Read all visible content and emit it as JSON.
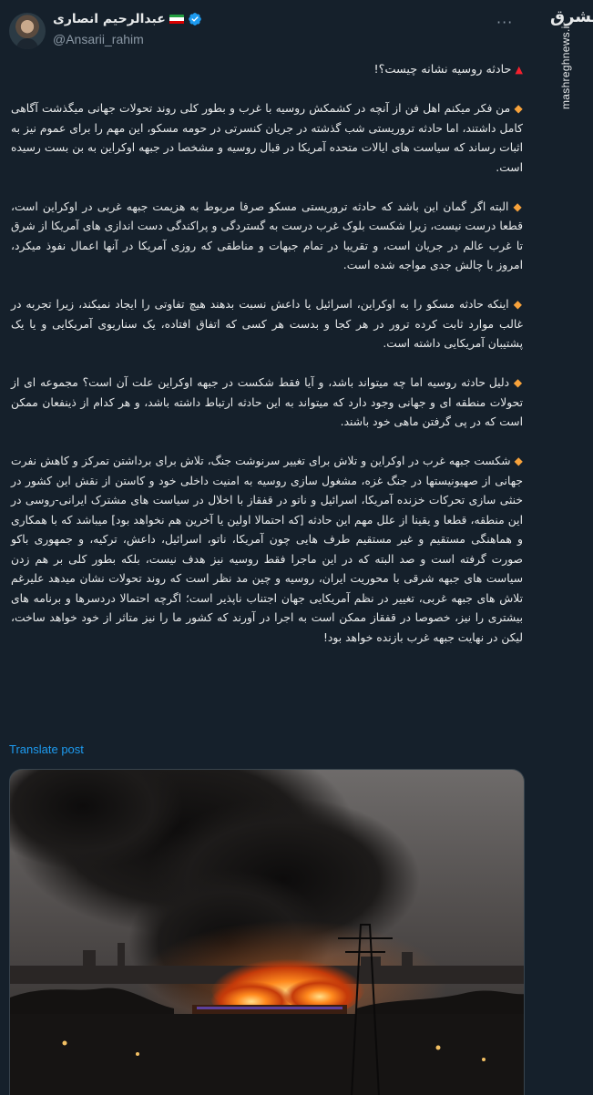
{
  "author": {
    "display_name": "عبدالرحیم انصاری",
    "handle": "@Ansarii_rahim",
    "flag_colors": [
      "#239f40",
      "#ffffff",
      "#da0000"
    ],
    "verified_color": "#1d9bf0"
  },
  "watermark": {
    "logo": "مشرق",
    "site": "mashreghnews.ir"
  },
  "tweet": {
    "title": "حادثه روسیه نشانه چیست؟!",
    "paragraphs": [
      "من فکر میکنم اهل فن از آنچه در کشمکش روسیه با غرب و بطور کلی روند تحولات جهانی میگذشت آگاهی کامل داشتند، اما حادثه تروریستی شب گذشته در جریان کنسرتی در حومه مسکو، این مهم را برای عموم نیز به اثبات رساند که سیاست های ایالات متحده آمریکا در قبال روسیه و مشخصا در جبهه اوکراین به بن بست رسیده است.",
      "البته اگر گمان این باشد که حادثه تروریستی مسکو صرفا مربوط به هزیمت جبهه غربی در اوکراین است، قطعا درست نیست، زیرا شکست بلوک غرب درست به گستردگی و پراکندگی دست اندازی های آمریکا از شرق تا غرب عالم در جریان است، و تقریبا در تمام جبهات و مناطقی که روزی آمریکا در آنها اعمال نفوذ میکرد، امروز با چالش جدی مواجه شده است.",
      "اینکه حادثه مسکو را به اوکراین، اسرائیل یا داعش نسبت بدهند هیچ تفاوتی را ایجاد نمیکند، زیرا تجربه در غالب موارد ثابت کرده ترور در هر کجا و بدست هر کسی که اتفاق افتاده، یک سناریوی آمریکایی و یا یک پشتیبان آمریکایی داشته است.",
      "دلیل حادثه روسیه اما چه میتواند باشد، و آیا فقط شکست در جبهه اوکراین علت آن است؟ مجموعه ای از تحولات منطقه ای و جهانی وجود دارد که میتواند به این حادثه ارتباط داشته باشد، و هر کدام از ذینفعان ممکن است که در پی گرفتن ماهی خود باشند.",
      "شکست جبهه غرب در اوکراین و تلاش برای تغییر سرنوشت جنگ، تلاش برای برداشتن تمرکز و کاهش نفرت جهانی از صهیونیستها در جنگ غزه، مشغول سازی روسیه به امنیت داخلی خود و کاستن از نقش این کشور در خنثی سازی تحرکات خزنده آمریکا، اسرائیل و ناتو در قفقاز با اخلال در سیاست های مشترک ایرانی-روسی در این منطقه، قطعا و یقینا از علل مهم این حادثه [که احتمالا اولین یا آخرین هم نخواهد بود] میباشد که با همکاری و هماهنگی مستقیم و غیر مستقیم طرف هایی چون آمریکا، ناتو، اسرائیل، داعش، ترکیه، و جمهوری باکو صورت گرفته است و صد البته که در این ماجرا فقط روسیه نیز هدف نیست، بلکه بطور کلی بر هم زدن سیاست های جبهه شرقی با محوریت ایران، روسیه و چین مد نظر است که روند تحولات نشان میدهد علیرغم تلاش های جبهه غربی، تغییر در نظم آمریکایی جهان اجتناب ناپذیر است؛ اگرچه احتمالا دردسرها و برنامه های بیشتری را نیز، خصوصا در قفقاز ممکن است به اجرا در آورند که کشور ما را نیز متاثر از خود خواهد ساخت، لیکن در نهایت جبهه غرب بازنده خواهد بود!"
    ],
    "translate_label": "Translate post"
  },
  "colors": {
    "background": "#15202b",
    "text": "#e7e9ea",
    "muted": "#8b98a5",
    "link": "#1d9bf0",
    "title_marker": "#f4212e",
    "bullet_marker": "#f7a23b"
  },
  "icons": {
    "title_marker": "▲",
    "bullet_marker": "◆",
    "more": "more-options-icon",
    "verified": "verified-badge-icon"
  }
}
